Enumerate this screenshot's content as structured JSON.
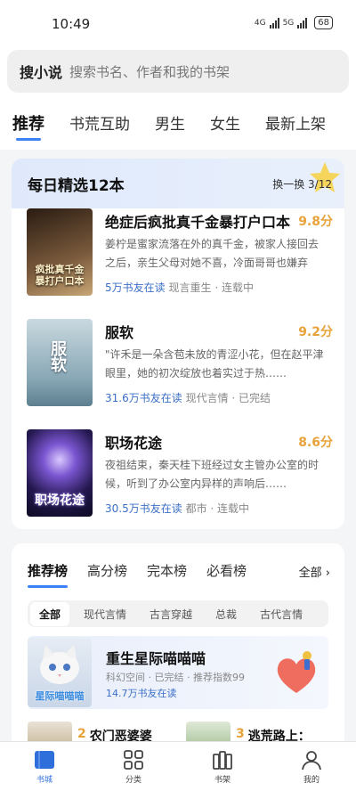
{
  "status": {
    "time": "10:49",
    "net1": "4G",
    "net2": "5G",
    "battery": "68"
  },
  "search": {
    "brand": "搜小说",
    "placeholder": "搜索书名、作者和我的书架"
  },
  "tabs": [
    {
      "label": "推荐",
      "active": true
    },
    {
      "label": "书荒互助",
      "active": false
    },
    {
      "label": "男生",
      "active": false
    },
    {
      "label": "女生",
      "active": false
    },
    {
      "label": "最新上架",
      "active": false
    }
  ],
  "daily": {
    "title": "每日精选12本",
    "refresh": "换一换 3/12",
    "books": [
      {
        "title": "绝症后疯批真千金暴打户口本",
        "score": "9.8分",
        "desc": "姜柠是蜜家流落在外的真千金，被家人接回去之后，亲生父母对她不喜，冷面哥哥也嫌弃她……",
        "readers": "5万书友在读",
        "genre": "现言重生",
        "state": "连载中",
        "cover_text": "疯批真千金暴打户口本",
        "cover_colors": [
          "#3a2a1e",
          "#8b6a4a"
        ]
      },
      {
        "title": "服软",
        "score": "9.2分",
        "desc": "\"许禾是一朵含苞未放的青涩小花，但在赵平津眼里，她的初次绽放也着实过于热……",
        "readers": "31.6万书友在读",
        "genre": "现代言情",
        "state": "已完结",
        "cover_text": "服软",
        "cover_colors": [
          "#9fb6c2",
          "#6c8fa0"
        ]
      },
      {
        "title": "职场花途",
        "score": "8.6分",
        "desc": "夜祖结束，秦天桂下班经过女主管办公室的时候，听到了办公室内异样的声响后……",
        "readers": "30.5万书友在读",
        "genre": "都市",
        "state": "连载中",
        "cover_text": "职场花途",
        "cover_colors": [
          "#1a1640",
          "#5a3fa8"
        ]
      }
    ]
  },
  "ranking": {
    "tabs": [
      {
        "label": "推荐榜",
        "active": true
      },
      {
        "label": "高分榜",
        "active": false
      },
      {
        "label": "完本榜",
        "active": false
      },
      {
        "label": "必看榜",
        "active": false
      }
    ],
    "all_label": "全部 ›",
    "chips": [
      {
        "label": "全部",
        "active": true
      },
      {
        "label": "现代言情",
        "active": false
      },
      {
        "label": "古言穿越",
        "active": false
      },
      {
        "label": "总裁",
        "active": false
      },
      {
        "label": "古代言情",
        "active": false
      }
    ],
    "featured": {
      "title": "重生星际喵喵喵",
      "meta": "科幻空间 · 已完结 · 推荐指数99",
      "readers": "14.7万书友在读",
      "cover_text": "星际喵喵喵"
    },
    "mini": [
      {
        "num": "2",
        "title": "农门恶婆婆"
      },
      {
        "num": "3",
        "title": "逃荒路上："
      }
    ]
  },
  "nav": [
    {
      "label": "书城",
      "icon": "book-icon",
      "active": true
    },
    {
      "label": "分类",
      "icon": "grid-icon",
      "active": false
    },
    {
      "label": "书架",
      "icon": "bookshelf-icon",
      "active": false
    },
    {
      "label": "我的",
      "icon": "user-icon",
      "active": false
    }
  ]
}
